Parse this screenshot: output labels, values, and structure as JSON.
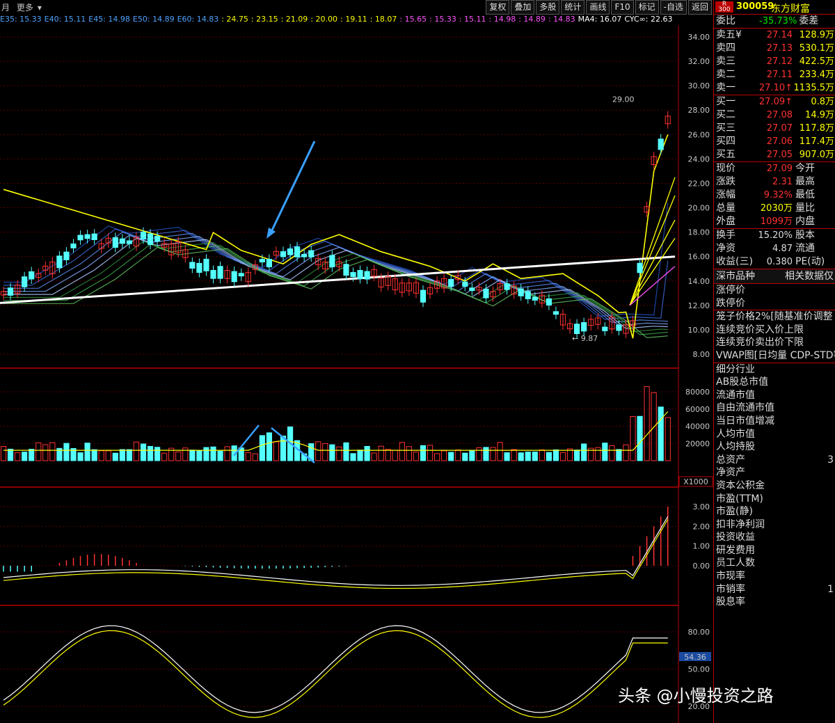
{
  "topbar": {
    "left_items": [
      "月",
      "更多"
    ],
    "tools": [
      "复权",
      "叠加",
      "多股",
      "统计",
      "画线",
      "F10",
      "标记",
      "-自选",
      "返回"
    ]
  },
  "ma_legend": [
    {
      "text": "E35: 15.33",
      "color": "#4fa3ff"
    },
    {
      "text": "E40: 15.11",
      "color": "#4fa3ff"
    },
    {
      "text": "E45: 14.98",
      "color": "#4fa3ff"
    },
    {
      "text": "E50: 14.89",
      "color": "#4fa3ff"
    },
    {
      "text": "E60: 14.83",
      "color": "#4fa3ff"
    },
    {
      "text": ": 24.75",
      "color": "#ffff00"
    },
    {
      "text": ": 23.15",
      "color": "#ffff00"
    },
    {
      "text": ": 21.09",
      "color": "#ffff00"
    },
    {
      "text": ": 20.00",
      "color": "#ffff00"
    },
    {
      "text": ": 19.11",
      "color": "#ffff00"
    },
    {
      "text": ": 18.07",
      "color": "#ffff00"
    },
    {
      "text": ": 15.65",
      "color": "#ff55ff"
    },
    {
      "text": ": 15.33",
      "color": "#ff55ff"
    },
    {
      "text": ": 15.11",
      "color": "#ff55ff"
    },
    {
      "text": ": 14.98",
      "color": "#ff55ff"
    },
    {
      "text": ": 14.89",
      "color": "#ff55ff"
    },
    {
      "text": ": 14.83",
      "color": "#ff55ff"
    },
    {
      "text": "MA4: 16.07",
      "color": "#ffffff"
    },
    {
      "text": "CYC∞: 22.63",
      "color": "#ffffff"
    }
  ],
  "price_axis": [
    "34.00",
    "32.00",
    "30.00",
    "28.00",
    "26.00",
    "24.00",
    "22.00",
    "20.00",
    "18.00",
    "16.00",
    "14.00",
    "12.00",
    "10.00",
    "8.00"
  ],
  "price_annotations": {
    "high": "29.00",
    "low": "9.87"
  },
  "volume_axis": [
    "80000",
    "60000",
    "40000",
    "20000"
  ],
  "volume_unit": "X1000",
  "macd_axis": [
    "3.00",
    "2.00",
    "1.00",
    "0.00"
  ],
  "kdj_axis": [
    "80.00",
    "50.00",
    "20.00"
  ],
  "kdj_current": "54.36",
  "colors": {
    "up": "#ff3232",
    "down": "#54ffff",
    "ma_yellow": "#ffff00",
    "ma_blue": "#4fa3ff",
    "panel_border": "#bb0000"
  },
  "stock": {
    "badge": "R 300",
    "code": "300059",
    "name": "东方财富"
  },
  "weibi": {
    "label": "委比",
    "value": "-35.73%",
    "label2": "委差"
  },
  "asks": [
    {
      "label": "卖五",
      "mark": "¥",
      "price": "27.14",
      "vol": "128.9万"
    },
    {
      "label": "卖四",
      "mark": "",
      "price": "27.13",
      "vol": "530.1万"
    },
    {
      "label": "卖三",
      "mark": "",
      "price": "27.12",
      "vol": "422.5万"
    },
    {
      "label": "卖二",
      "mark": "",
      "price": "27.11",
      "vol": "233.4万"
    },
    {
      "label": "卖一",
      "mark": "",
      "price": "27.10↑",
      "vol": "1135.5万"
    }
  ],
  "bids": [
    {
      "label": "买一",
      "price": "27.09↑",
      "vol": "0.8万"
    },
    {
      "label": "买二",
      "price": "27.08",
      "vol": "14.9万"
    },
    {
      "label": "买三",
      "price": "27.07",
      "vol": "117.8万"
    },
    {
      "label": "买四",
      "price": "27.06",
      "vol": "117.4万"
    },
    {
      "label": "买五",
      "price": "27.05",
      "vol": "907.0万"
    }
  ],
  "quote": [
    {
      "l": "现价",
      "v": "27.09",
      "vc": "red",
      "r": "今开"
    },
    {
      "l": "涨跌",
      "v": "2.31",
      "vc": "red",
      "r": "最高"
    },
    {
      "l": "涨幅",
      "v": "9.32%",
      "vc": "red",
      "r": "最低"
    },
    {
      "l": "总量",
      "v": "2030万",
      "vc": "yel",
      "r": "量比"
    },
    {
      "l": "外盘",
      "v": "1099万",
      "vc": "red",
      "r": "内盘"
    }
  ],
  "fund": [
    {
      "l": "换手",
      "v": "15.20%",
      "r": "股本"
    },
    {
      "l": "净资",
      "v": "4.87",
      "r": "流通"
    },
    {
      "l": "收益(三)",
      "v": "0.380",
      "r": "PE(动)"
    }
  ],
  "section_header": {
    "left": "深市品种",
    "right": "相关数据仅"
  },
  "list1": [
    "涨停价",
    "跌停价"
  ],
  "list2": [
    "笼子价格2%[随基准价调整",
    "连续竞价买入价上限",
    "连续竞价卖出价下限",
    "VWAP图[日均量 CDP-STD等"
  ],
  "list3": [
    "细分行业",
    "AB股总市值",
    "流通市值",
    "自由流通市值",
    "当日市值增减",
    "人均市值",
    "人均持股",
    "总资产",
    "净资产",
    "资本公积金",
    "市盈(TTM)",
    "市盈(静)",
    "扣非净利润",
    "投资收益",
    "研发费用",
    "员工人数",
    "市现率",
    "市销率",
    "股息率"
  ],
  "list3_values": {
    "总资产": "3",
    "市销率": "1"
  },
  "watermark": "头条 @小慢投资之路"
}
